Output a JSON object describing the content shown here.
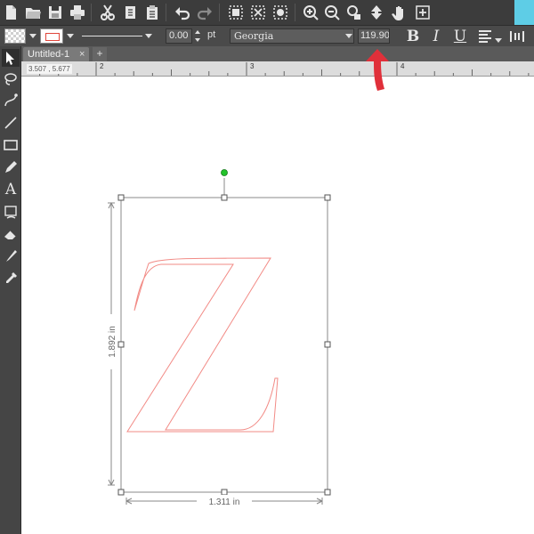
{
  "document": {
    "tab_title": "Untitled-1",
    "tab_close": "×",
    "new_tab": "+"
  },
  "toolbar": {
    "icons": [
      "new-document",
      "open-folder",
      "save",
      "print",
      "cut",
      "copy",
      "paste",
      "undo",
      "redo",
      "group",
      "ungroup",
      "trace",
      "zoom-in",
      "zoom-out",
      "zoom-fit",
      "move-down",
      "pan-hand",
      "add-frame"
    ],
    "accent": "#5ecde6"
  },
  "properties": {
    "stroke_width": "0.00",
    "stroke_unit": "pt",
    "font_family": "Georgia",
    "font_size": "119.90",
    "bold_label": "B",
    "italic_label": "I",
    "underline_label": "U",
    "stroke_color": "#e0463c"
  },
  "ruler": {
    "coordinates": "3.507 , 5.677",
    "labels": [
      "2",
      "3",
      "4"
    ]
  },
  "canvas": {
    "glyph": "Z",
    "height_dim": "1.892 in",
    "width_dim": "1.311 in",
    "glyph_outline_color": "#f28b86",
    "rotate_handle_color": "#22c32a",
    "annotation_arrow_color": "#e0303a"
  }
}
